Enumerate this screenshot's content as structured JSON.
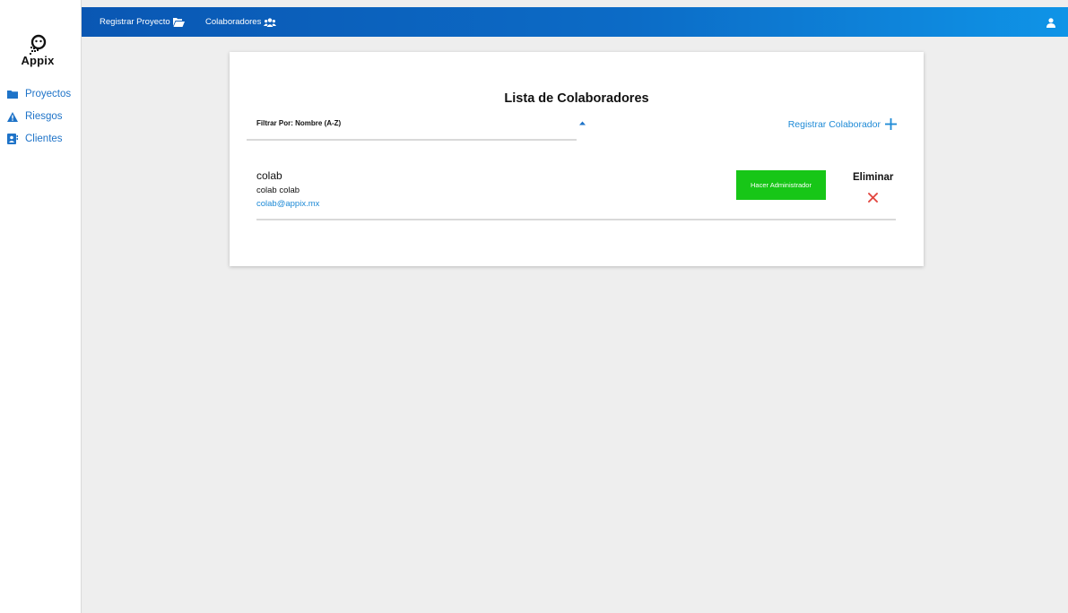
{
  "brand": {
    "logo_text": "Appix"
  },
  "sidebar": {
    "items": [
      {
        "label": "Proyectos",
        "icon": "folder-icon"
      },
      {
        "label": "Riesgos",
        "icon": "warning-icon"
      },
      {
        "label": "Clientes",
        "icon": "contact-card-icon"
      }
    ]
  },
  "topbar": {
    "links": [
      {
        "label": "Registrar Proyecto",
        "icon": "folder-open-icon"
      },
      {
        "label": "Colaboradores",
        "icon": "users-icon"
      }
    ],
    "user_icon": "user-icon"
  },
  "card": {
    "title": "Lista de Colaboradores",
    "filter_label": "Filtrar Por: Nombre (A-Z)",
    "register_label": "Registrar Colaborador",
    "delete_label": "Eliminar",
    "collaborators": [
      {
        "username": "colab",
        "full_name": "colab colab",
        "email": "colab@appix.mx",
        "action_label": "Hacer Administrador"
      }
    ]
  },
  "colors": {
    "accent": "#1e73c8",
    "link": "#1e8ad6",
    "success": "#17c617",
    "danger": "#e2463f",
    "topbar_start": "#0a57b3",
    "topbar_end": "#0f94e7"
  }
}
